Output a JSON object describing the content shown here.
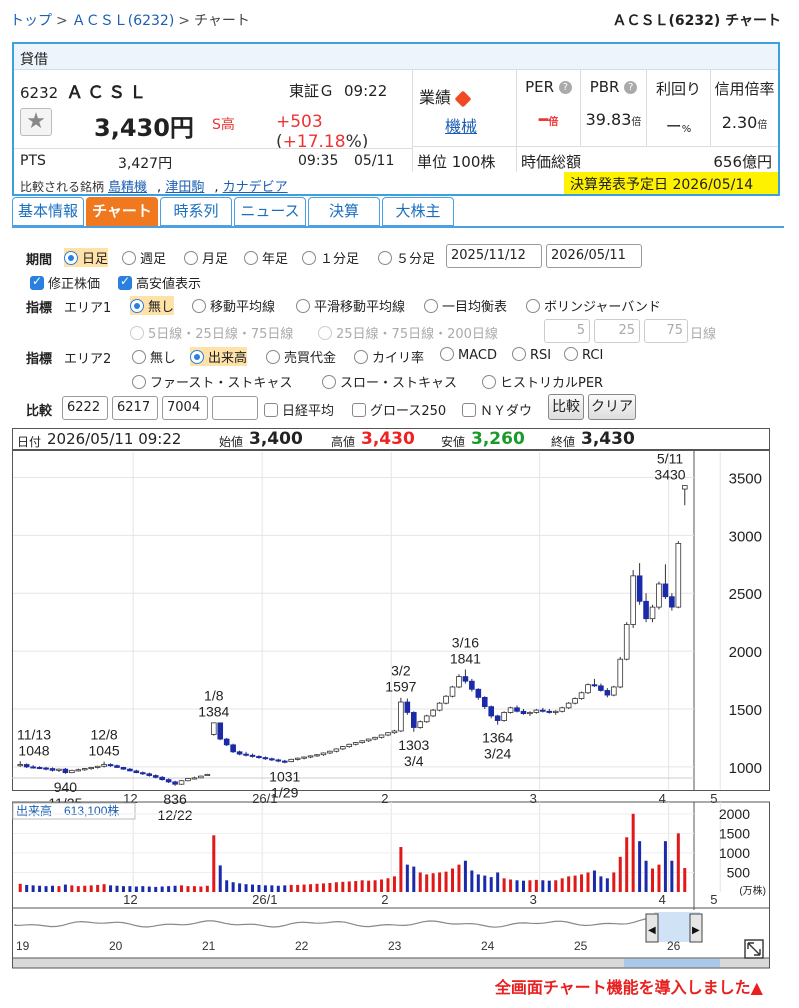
{
  "breadcrumb": {
    "top": "トップ",
    "sep": ">",
    "company": "ＡＣＳＬ(6232)",
    "current": "チャート"
  },
  "page_title": "ＡＣＳＬ(6232) チャート",
  "quote": {
    "margin_label": "貸借",
    "code": "6232",
    "name": "ＡＣＳＬ",
    "market": "東証Ｇ",
    "time": "09:22",
    "price": "3,430円",
    "stop_high": "S高",
    "change": "+503",
    "change_pct_open": "(",
    "change_pct": "+17.18",
    "change_pct_close": "%)",
    "pts_label": "PTS",
    "pts_price": "3,427円",
    "pts_time": "09:35",
    "pts_date": "05/11",
    "gyoseki_label": "業績",
    "sector": "機械",
    "unit": "単位 100株",
    "per_label": "PER",
    "per_value": "━",
    "per_unit": "倍",
    "pbr_label": "PBR",
    "pbr_value": "39.83",
    "pbr_unit": "倍",
    "yield_label": "利回り",
    "yield_value": "ー",
    "yield_unit": "%",
    "margin_ratio_label": "信用倍率",
    "margin_ratio_value": "2.30",
    "margin_ratio_unit": "倍",
    "mcap_label": "時価総額",
    "mcap_value": "656億円",
    "compare_label": "比較される銘柄",
    "compare": [
      "島精機",
      "津田駒",
      "カナデビア"
    ],
    "comma": ",",
    "earnings": "決算発表予定日 2026/05/14",
    "help_icon": "?"
  },
  "tabs": [
    "基本情報",
    "チャート",
    "時系列",
    "ニュース",
    "決算",
    "大株主"
  ],
  "form": {
    "period_label": "期間",
    "period_options": [
      "日足",
      "週足",
      "月足",
      "年足",
      "１分足",
      "５分足"
    ],
    "date_from": "2025/11/12",
    "date_to": "2026/05/11",
    "adjusted": "修正株価",
    "high_low": "高安値表示",
    "indicator_label": "指標",
    "area1_label": "エリア1",
    "area1_options": [
      "無し",
      "移動平均線",
      "平滑移動平均線",
      "一目均衡表",
      "ボリンジャーバンド"
    ],
    "ma_options": [
      "5日線・25日線・75日線",
      "25日線・75日線・200日線"
    ],
    "ma_inputs": [
      "5",
      "25",
      "75"
    ],
    "ma_unit": "日線",
    "area2_label": "エリア2",
    "area2_options": [
      "無し",
      "出来高",
      "売買代金",
      "カイリ率",
      "MACD",
      "RSI",
      "RCI"
    ],
    "area2_options_row2": [
      "ファースト・ストキャス",
      "スロー・ストキャス",
      "ヒストリカルPER"
    ],
    "compare_label": "比較",
    "compare_codes": [
      "6222",
      "6217",
      "7004",
      ""
    ],
    "compare_checks": [
      "日経平均",
      "グロース250",
      "ＮＹダウ"
    ],
    "compare_button": "比較",
    "clear_button": "クリア"
  },
  "chart_header": {
    "date_label": "日付",
    "date": "2026/05/11 09:22",
    "open_label": "始値",
    "open": "3,400",
    "high_label": "高値",
    "high": "3,430",
    "low_label": "安値",
    "low": "3,260",
    "close_label": "終値",
    "close": "3,430"
  },
  "chart_data": {
    "type": "candlestick",
    "yticks": [
      "3500",
      "3000",
      "2500",
      "2000",
      "1500",
      "1000"
    ],
    "ylim": [
      800,
      3720
    ],
    "month_labels": [
      "12",
      "26/1",
      "2",
      "3",
      "4",
      "5"
    ],
    "volume_label": "出来高",
    "volume_value": "613,100株",
    "volume_ticks": [
      "2000",
      "1500",
      "1000",
      "500"
    ],
    "volume_unit": "(万株)",
    "volume_ylim": [
      0,
      2200
    ],
    "nav_labels": [
      "19",
      "20",
      "21",
      "22",
      "23",
      "24",
      "25",
      "26"
    ],
    "annotations": [
      {
        "label": "11/13",
        "value": "1048"
      },
      {
        "label": "11/25",
        "value": "940"
      },
      {
        "label": "12/8",
        "value": "1045"
      },
      {
        "label": "12/22",
        "value": "836"
      },
      {
        "label": "1/8",
        "value": "1384"
      },
      {
        "label": "1/29",
        "value": "1031"
      },
      {
        "label": "3/2",
        "value": "1597"
      },
      {
        "label": "3/4",
        "value": "1303"
      },
      {
        "label": "3/16",
        "value": "1841"
      },
      {
        "label": "3/24",
        "value": "1364"
      },
      {
        "label": "5/11",
        "value": "3430"
      }
    ],
    "candles": [
      [
        1010,
        1048,
        1000,
        1020
      ],
      [
        1020,
        1030,
        990,
        1000
      ],
      [
        1000,
        1015,
        985,
        995
      ],
      [
        995,
        1005,
        980,
        990
      ],
      [
        990,
        1000,
        970,
        985
      ],
      [
        985,
        995,
        960,
        970
      ],
      [
        970,
        985,
        955,
        980
      ],
      [
        980,
        990,
        940,
        950
      ],
      [
        950,
        975,
        945,
        970
      ],
      [
        970,
        985,
        960,
        975
      ],
      [
        975,
        990,
        965,
        985
      ],
      [
        985,
        1000,
        975,
        995
      ],
      [
        995,
        1010,
        985,
        1005
      ],
      [
        1005,
        1045,
        995,
        1020
      ],
      [
        1020,
        1030,
        1000,
        1010
      ],
      [
        1010,
        1020,
        990,
        995
      ],
      [
        995,
        1000,
        975,
        980
      ],
      [
        980,
        990,
        960,
        965
      ],
      [
        965,
        975,
        945,
        950
      ],
      [
        950,
        960,
        930,
        940
      ],
      [
        940,
        950,
        915,
        925
      ],
      [
        925,
        935,
        900,
        910
      ],
      [
        910,
        920,
        880,
        890
      ],
      [
        890,
        900,
        860,
        870
      ],
      [
        870,
        880,
        836,
        850
      ],
      [
        850,
        885,
        845,
        880
      ],
      [
        880,
        905,
        875,
        900
      ],
      [
        900,
        915,
        890,
        905
      ],
      [
        905,
        925,
        900,
        920
      ],
      [
        930,
        940,
        925,
        935
      ],
      [
        1280,
        1384,
        1270,
        1380
      ],
      [
        1380,
        1380,
        1230,
        1240
      ],
      [
        1240,
        1250,
        1180,
        1190
      ],
      [
        1190,
        1200,
        1120,
        1130
      ],
      [
        1130,
        1140,
        1100,
        1110
      ],
      [
        1110,
        1130,
        1090,
        1100
      ],
      [
        1100,
        1115,
        1080,
        1090
      ],
      [
        1090,
        1100,
        1070,
        1080
      ],
      [
        1080,
        1090,
        1060,
        1070
      ],
      [
        1070,
        1080,
        1050,
        1060
      ],
      [
        1060,
        1070,
        1040,
        1050
      ],
      [
        1050,
        1060,
        1031,
        1045
      ],
      [
        1045,
        1070,
        1040,
        1065
      ],
      [
        1065,
        1080,
        1055,
        1075
      ],
      [
        1075,
        1090,
        1065,
        1085
      ],
      [
        1085,
        1100,
        1075,
        1095
      ],
      [
        1095,
        1110,
        1085,
        1105
      ],
      [
        1105,
        1125,
        1095,
        1120
      ],
      [
        1120,
        1140,
        1110,
        1135
      ],
      [
        1135,
        1160,
        1125,
        1155
      ],
      [
        1155,
        1180,
        1145,
        1175
      ],
      [
        1175,
        1200,
        1165,
        1195
      ],
      [
        1195,
        1215,
        1185,
        1210
      ],
      [
        1210,
        1230,
        1200,
        1225
      ],
      [
        1225,
        1245,
        1215,
        1240
      ],
      [
        1240,
        1260,
        1230,
        1255
      ],
      [
        1255,
        1280,
        1245,
        1275
      ],
      [
        1275,
        1300,
        1265,
        1295
      ],
      [
        1295,
        1320,
        1285,
        1310
      ],
      [
        1310,
        1597,
        1300,
        1560
      ],
      [
        1560,
        1590,
        1450,
        1470
      ],
      [
        1470,
        1480,
        1303,
        1340
      ],
      [
        1340,
        1400,
        1330,
        1390
      ],
      [
        1390,
        1450,
        1380,
        1440
      ],
      [
        1440,
        1500,
        1430,
        1490
      ],
      [
        1490,
        1560,
        1480,
        1550
      ],
      [
        1550,
        1620,
        1540,
        1610
      ],
      [
        1610,
        1700,
        1600,
        1690
      ],
      [
        1690,
        1800,
        1680,
        1780
      ],
      [
        1780,
        1841,
        1720,
        1740
      ],
      [
        1740,
        1760,
        1650,
        1670
      ],
      [
        1670,
        1680,
        1580,
        1600
      ],
      [
        1600,
        1610,
        1500,
        1520
      ],
      [
        1520,
        1530,
        1420,
        1440
      ],
      [
        1440,
        1450,
        1364,
        1400
      ],
      [
        1400,
        1480,
        1390,
        1470
      ],
      [
        1470,
        1520,
        1460,
        1510
      ],
      [
        1510,
        1530,
        1470,
        1480
      ],
      [
        1480,
        1500,
        1450,
        1460
      ],
      [
        1460,
        1480,
        1440,
        1470
      ],
      [
        1470,
        1500,
        1460,
        1490
      ],
      [
        1490,
        1510,
        1470,
        1480
      ],
      [
        1480,
        1500,
        1460,
        1470
      ],
      [
        1470,
        1490,
        1450,
        1480
      ],
      [
        1480,
        1520,
        1470,
        1510
      ],
      [
        1510,
        1560,
        1500,
        1550
      ],
      [
        1550,
        1600,
        1540,
        1590
      ],
      [
        1590,
        1650,
        1580,
        1640
      ],
      [
        1640,
        1720,
        1630,
        1710
      ],
      [
        1710,
        1760,
        1690,
        1700
      ],
      [
        1700,
        1720,
        1650,
        1660
      ],
      [
        1660,
        1680,
        1600,
        1620
      ],
      [
        1620,
        1700,
        1610,
        1690
      ],
      [
        1690,
        1950,
        1680,
        1930
      ],
      [
        1930,
        2250,
        1920,
        2230
      ],
      [
        2230,
        2700,
        2200,
        2650
      ],
      [
        2650,
        2760,
        2400,
        2430
      ],
      [
        2430,
        2500,
        2250,
        2280
      ],
      [
        2280,
        2400,
        2250,
        2380
      ],
      [
        2380,
        2600,
        2360,
        2580
      ],
      [
        2580,
        2750,
        2450,
        2470
      ],
      [
        2470,
        2500,
        2350,
        2380
      ],
      [
        2380,
        2950,
        2370,
        2930
      ],
      [
        3400,
        3430,
        3260,
        3430
      ]
    ],
    "volumes": [
      210,
      180,
      170,
      160,
      150,
      160,
      150,
      190,
      170,
      150,
      160,
      170,
      180,
      200,
      170,
      160,
      150,
      150,
      140,
      150,
      140,
      130,
      140,
      150,
      160,
      170,
      150,
      150,
      140,
      160,
      1450,
      680,
      300,
      250,
      220,
      200,
      190,
      180,
      170,
      170,
      160,
      170,
      180,
      180,
      190,
      200,
      210,
      220,
      230,
      250,
      260,
      270,
      280,
      300,
      290,
      300,
      320,
      350,
      400,
      1150,
      700,
      650,
      500,
      450,
      480,
      500,
      520,
      600,
      700,
      800,
      550,
      450,
      420,
      380,
      500,
      350,
      320,
      300,
      290,
      300,
      310,
      300,
      290,
      300,
      350,
      400,
      420,
      450,
      500,
      550,
      400,
      350,
      500,
      900,
      1400,
      2000,
      1300,
      800,
      600,
      700,
      1300,
      800,
      1500,
      613
    ]
  },
  "note": "全画面チャート機能を導入しました▲"
}
